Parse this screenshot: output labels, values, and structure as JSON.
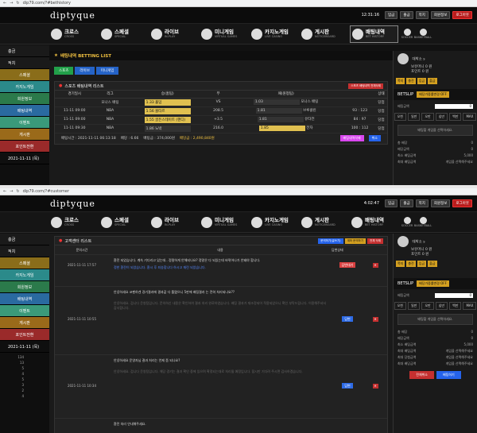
{
  "shot1": {
    "url": "dip79.com/?#bethistory",
    "logo": "diptyque",
    "clock": "12:31:16",
    "top_buttons": [
      "입금",
      "출금",
      "쪽지",
      "회원정보",
      "로그아웃"
    ],
    "nav": [
      {
        "t": "크로스",
        "s": "CROSS"
      },
      {
        "t": "스페셜",
        "s": "SPECIAL"
      },
      {
        "t": "라이브",
        "s": "IN-PLAY"
      },
      {
        "t": "미니게임",
        "s": "VIRTUAL GAMES"
      },
      {
        "t": "카지노게임",
        "s": "LIVE CASINO"
      },
      {
        "t": "게시판",
        "s": "NOTICEBOARD"
      },
      {
        "t": "배팅내역",
        "s": "BET HISTORY"
      }
    ],
    "nav_small": [
      "SOCCER",
      "BASKETBALL"
    ],
    "sidebar": [
      "충금",
      "적치",
      "스페셜",
      "카지노게임",
      "회원정보",
      "배팅내역",
      "이벤트",
      "게시판",
      "포인트전환"
    ],
    "sidebar_time": "2021-11-11 (목)",
    "page_title": "배팅내역 BETTING LIST",
    "tabs": [
      "스포츠",
      "라이브",
      "미니게임"
    ],
    "panel_title": "스포츠 배팅내역 리스트",
    "panel_btn": "스포츠 배팅내역 전체삭제",
    "headers": [
      "경기일시",
      "리그",
      "승(홈팀)",
      "무",
      "패(원정팀)",
      "상태"
    ],
    "rows": [
      [
        "",
        "모나스 배팅",
        "1.33 홀덤",
        "VS",
        "1.03",
        "모나스 배팅",
        "당첨"
      ],
      [
        "11-11 09:00",
        "NBA",
        "1.56 볼타르",
        "208.5",
        "1.81",
        "브루클린",
        "93 : 123",
        "당첨"
      ],
      [
        "11-11 09:00",
        "NBA",
        "1.55 골든스테이트 (핸디)",
        "+3.5",
        "1.81",
        "유타전",
        "84 : 97",
        "당첨"
      ],
      [
        "11-11 09:30",
        "NBA",
        "1.86 노박",
        "216.0",
        "1.85",
        "전자",
        "100 : 112",
        "당첨"
      ]
    ],
    "foot": {
      "time": "배팅시간 : 2021-11-11 06:13:18",
      "odds": "배당 : 6.66",
      "amount": "배팅금 : 374,000원",
      "win": "배당금 : 2,490,840원",
      "btn1": "배팅내역삭제",
      "btn2": "취소"
    },
    "user": {
      "name": "대박소 s",
      "money": "보유머니 0 원",
      "point": "포인트 0 원"
    },
    "user_buttons": [
      "쪽지",
      "충전",
      "입금",
      "출금"
    ],
    "betslip": "BETSLIP",
    "betslip_btn": "배당가중률변경 OFF",
    "bet_amount_label": "배팅금액",
    "bet_amount": "0",
    "amount_buttons": [
      "오천",
      "일만",
      "오만",
      "십만",
      "백만",
      "MAX"
    ],
    "slip_msg": "배팅할 게임을 선택하세요.",
    "slip_rows": [
      [
        "총 배당",
        "0"
      ],
      [
        "배당금액",
        "0"
      ],
      [
        "최소 배팅금액",
        "5,000"
      ],
      [
        "최대 배팅금액",
        "게임을 선택해주세요"
      ]
    ]
  },
  "shot2": {
    "url": "dip79.com/?#customer",
    "logo": "diptyque",
    "clock": "4:02:47",
    "top_buttons": [
      "입금",
      "출금",
      "쪽지",
      "회원정보",
      "로그아웃"
    ],
    "sidebar": [
      "충금",
      "적치",
      "스페셜",
      "카지노게임",
      "회원정보",
      "배팅내역",
      "이벤트",
      "게시판",
      "포인트전환"
    ],
    "sidebar_time": "2021-11-11 (목)",
    "side_stats": [
      "134",
      "13",
      "5",
      "4",
      "5",
      "3",
      "2",
      "4"
    ],
    "panel_title": "고객센터 리스트",
    "panel_btns": [
      "문의하기(글쓰기)",
      "계좌 문의하기",
      "전체 삭제"
    ],
    "headers": [
      "문의시간",
      "내용",
      "답변상태"
    ],
    "rows": [
      {
        "date": "2021-11-11 17:57",
        "q": "환전 되었습니다. 계속 기다리고 있는데.. 정말하게 안해되나요? 정말은 다 되있는데 바뀌어나가 안돼야 합니다.",
        "a": "정한 환전이 되었습니다. 환시 후 죄송합니다 하시고 재린 되었습니다.",
        "status": "답변대기",
        "status_color": "red"
      },
      {
        "date": "2021-11-11 10:55",
        "q": "안녕하세요 코펜하겐 경기결과에 결과값 다 틀렸으니 5판에 배팅결과 는 전혀 처리되나요??",
        "a": "안녕하세요. 겁니다 운영팀입니다. 문의하신 내용은 확인하여 결과 처리 완료하였습니다. 배팅 결과가 재조정되어 적용되었으니 확인 부탁드립니다. 이용해주셔서 감사합니다.",
        "status": "답변",
        "status_color": "blue"
      },
      {
        "date": "2021-11-11 10:34",
        "q": "안녕하세요 운영자님 결과 처리는 언제 쯤 되나요?",
        "a": "안녕하세요. 겁니다 운영팀입니다. 해당 경기는 결과 확인 중에 있으며 확정되는대로 처리될 예정입니다. 잠시만 기다려 주시면 감사하겠습니다.",
        "status": "답변",
        "status_color": "blue"
      },
      {
        "date": "",
        "q": "환전 처리 안내해주세요.",
        "a": "",
        "status": "",
        "status_color": "red"
      }
    ],
    "user": {
      "name": "대박소 s",
      "money": "보유머니 0 원",
      "point": "포인트 0 원"
    },
    "user_buttons": [
      "쪽지",
      "충전",
      "입금",
      "출금"
    ],
    "betslip": "BETSLIP",
    "betslip_btn": "배당가중률변경 OFF",
    "bet_amount_label": "배팅금액",
    "bet_amount": "0",
    "amount_buttons": [
      "오천",
      "일만",
      "오만",
      "십만",
      "백만",
      "MAX"
    ],
    "slip_msg": "배팅할 게임을 선택하세요.",
    "slip_rows": [
      [
        "총 배당",
        "0"
      ],
      [
        "배당금액",
        "0"
      ],
      [
        "최소 배팅금액",
        "5,000"
      ],
      [
        "최대 배팅금액",
        "게임을 선택해주세요"
      ],
      [
        "최대 당첨금액",
        "게임을 선택해주세요"
      ],
      [
        "최대 배당금액",
        "게임을 선택해주세요"
      ]
    ],
    "bottom_btns": [
      "전체취소",
      "배팅하기"
    ]
  },
  "colors": {
    "accent_gold": "#d4a020",
    "danger": "#c53030",
    "primary": "#2563eb",
    "bg": "#111111"
  }
}
